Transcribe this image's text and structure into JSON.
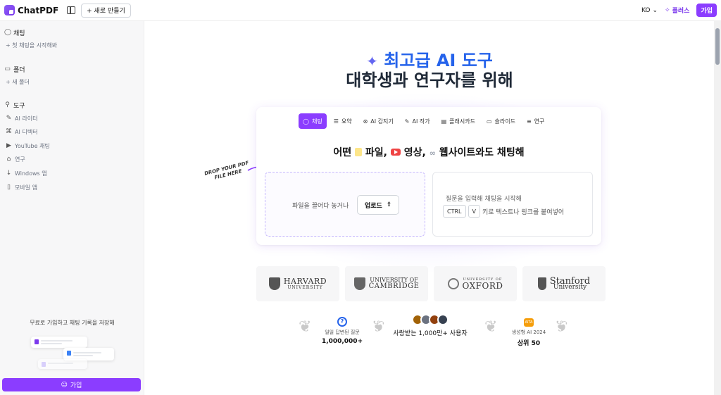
{
  "topbar": {
    "brand": "ChatPDF",
    "new_button": "+ 새로 만들기",
    "lang": "KO",
    "plus_label": "플러스",
    "signup_label": "가입"
  },
  "sidebar": {
    "chat_title": "채팅",
    "chat_start": "+ 첫 채팅을 시작해봐",
    "folder_title": "폴더",
    "new_folder": "+ 새 폴더",
    "tools_title": "도구",
    "tools": [
      {
        "label": "AI 라이터",
        "icon": "pencil-icon"
      },
      {
        "label": "AI 디텍터",
        "icon": "ai-icon"
      },
      {
        "label": "YouTube 채팅",
        "icon": "youtube-icon"
      },
      {
        "label": "연구",
        "icon": "graduation-icon"
      },
      {
        "label": "Windows 앱",
        "icon": "download-icon"
      },
      {
        "label": "모바일 앱",
        "icon": "mobile-icon"
      }
    ],
    "save_prompt": "무료로 가입하고 채팅 기록을 저장해",
    "signup_label": "가입"
  },
  "hero": {
    "line1": "최고급 AI 도구",
    "line2": "대학생과 연구자를 위해"
  },
  "panel": {
    "tabs": [
      {
        "label": "채팅",
        "icon": "chat-icon",
        "active": true
      },
      {
        "label": "요약",
        "icon": "list-icon",
        "active": false
      },
      {
        "label": "AI 감지기",
        "icon": "detector-icon",
        "active": false
      },
      {
        "label": "AI 작가",
        "icon": "pencil-icon",
        "active": false
      },
      {
        "label": "플래시카드",
        "icon": "card-icon",
        "active": false
      },
      {
        "label": "슬라이드",
        "icon": "slides-icon",
        "active": false
      },
      {
        "label": "연구",
        "icon": "research-icon",
        "active": false
      }
    ],
    "title_a": "어떤",
    "title_b": "파일,",
    "title_c": "영상,",
    "title_d": "웹사이트와도 채팅해",
    "drop_text": "파일을 끌어다 놓거나",
    "upload_label": "업로드",
    "ask_text": "질문을 입력해 채팅을 시작해",
    "key1": "CTRL",
    "key2": "V",
    "paste_text": "키로 텍스트나 링크를 붙여넣어"
  },
  "drop_hint": "DROP YOUR PDF FILE HERE",
  "universities": [
    {
      "name": "HARVARD",
      "sub": "UNIVERSITY"
    },
    {
      "name": "UNIVERSITY OF",
      "sub": "CAMBRIDGE"
    },
    {
      "name": "UNIVERSITY OF",
      "sub": "OXFORD"
    },
    {
      "name": "Stanford",
      "sub": "University"
    }
  ],
  "stats": {
    "questions_label": "일일 답변된 질문",
    "questions_value": "1,000,000+",
    "users_label": "사랑받는 1,000만+ 사용자",
    "award_badge": "AITA",
    "award_label": "생성형 AI 2024",
    "award_value": "상위 50"
  },
  "colors": {
    "accent": "#8b3dff",
    "hero_blue": "#2563eb"
  }
}
